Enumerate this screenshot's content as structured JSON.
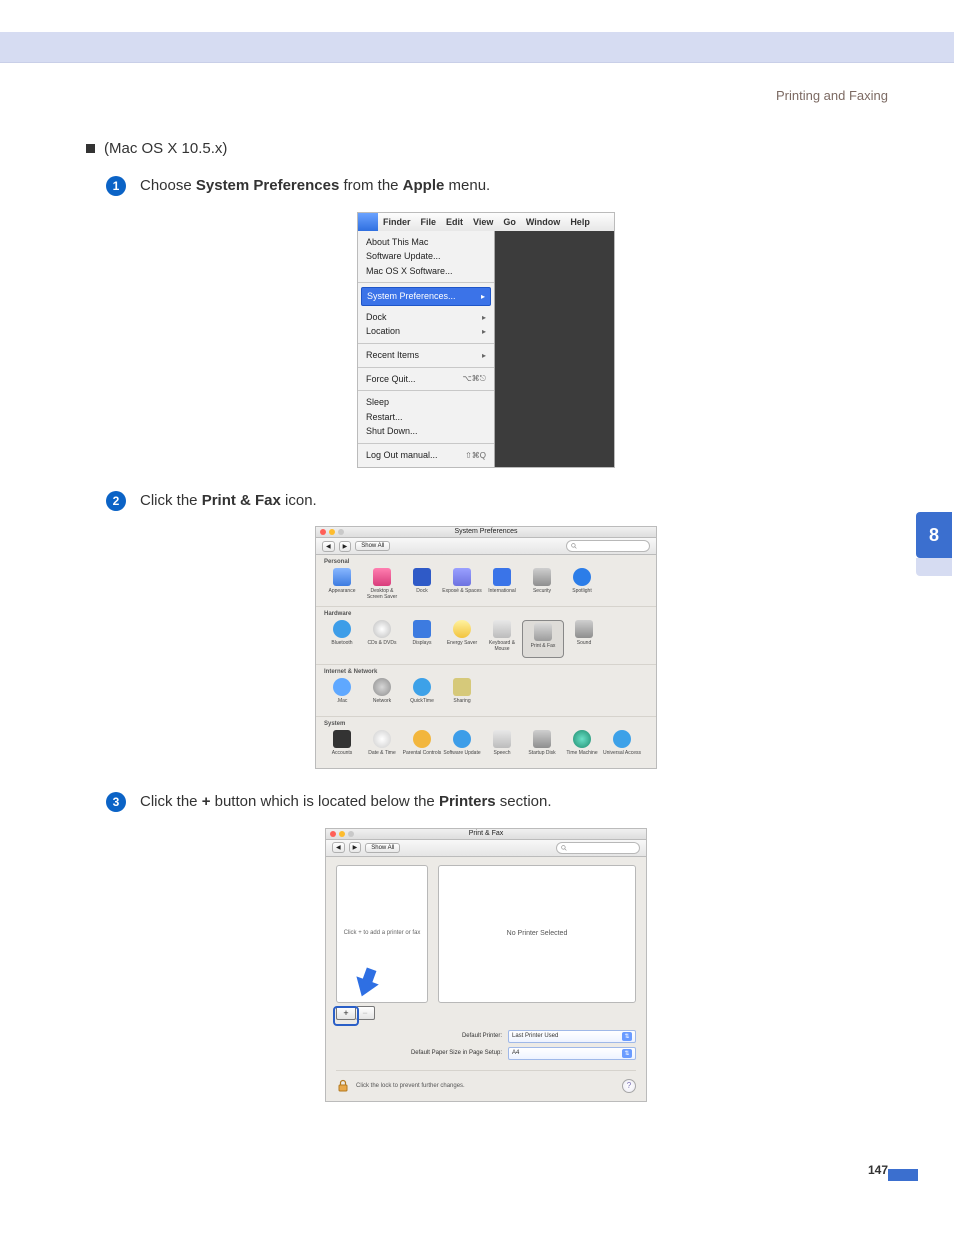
{
  "header": {
    "right": "Printing and Faxing"
  },
  "section": {
    "title": "(Mac OS X 10.5.x)"
  },
  "sideTab": "8",
  "pageNumber": "147",
  "steps": {
    "s1": {
      "pre": "Choose ",
      "b1": "System Preferences",
      "mid": " from the ",
      "b2": "Apple",
      "post": " menu."
    },
    "s2": {
      "pre": "Click the ",
      "b1": "Print & Fax",
      "post": " icon."
    },
    "s3": {
      "pre": "Click the ",
      "b1": "+",
      "mid": " button which is located below the ",
      "b2": "Printers",
      "post": " section."
    }
  },
  "shot1": {
    "menubar": {
      "app": "Finder",
      "items": [
        "File",
        "Edit",
        "View",
        "Go",
        "Window",
        "Help"
      ]
    },
    "menu": {
      "about": "About This Mac",
      "swupdate": "Software Update...",
      "macosx": "Mac OS X Software...",
      "sysprefs": "System Preferences...",
      "dock": "Dock",
      "location": "Location",
      "recent": "Recent Items",
      "forcequit": "Force Quit...",
      "forcequit_sc": "⌥⌘⎋",
      "sleep": "Sleep",
      "restart": "Restart...",
      "shutdown": "Shut Down...",
      "logout": "Log Out manual...",
      "logout_sc": "⇧⌘Q"
    }
  },
  "shot2": {
    "title": "System Preferences",
    "showAll": "Show All",
    "cats": {
      "personal": "Personal",
      "hardware": "Hardware",
      "internet": "Internet & Network",
      "system": "System"
    },
    "items": {
      "personal": [
        "Appearance",
        "Desktop & Screen Saver",
        "Dock",
        "Exposé & Spaces",
        "International",
        "Security",
        "Spotlight"
      ],
      "hardware": [
        "Bluetooth",
        "CDs & DVDs",
        "Displays",
        "Energy Saver",
        "Keyboard & Mouse",
        "Print & Fax",
        "Sound"
      ],
      "internet": [
        ".Mac",
        "Network",
        "QuickTime",
        "Sharing"
      ],
      "system": [
        "Accounts",
        "Date & Time",
        "Parental Controls",
        "Software Update",
        "Speech",
        "Startup Disk",
        "Time Machine",
        "Universal Access"
      ]
    }
  },
  "shot3": {
    "title": "Print & Fax",
    "showAll": "Show All",
    "emptyList": "Click + to add a printer or fax",
    "noPrinter": "No Printer Selected",
    "defPrinterLbl": "Default Printer:",
    "defPrinterVal": "Last Printer Used",
    "paperLbl": "Default Paper Size in Page Setup:",
    "paperVal": "A4",
    "lock": "Click the lock to prevent further changes."
  }
}
